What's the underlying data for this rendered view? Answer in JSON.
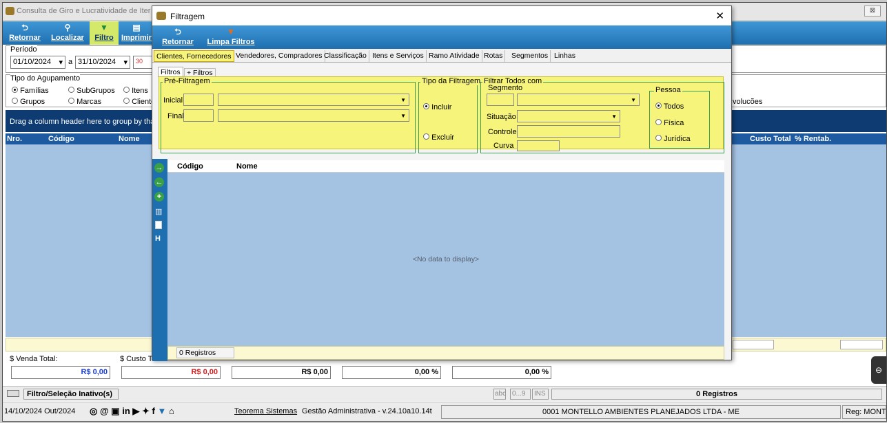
{
  "main": {
    "title": "Consulta de Giro e Lucratividade de Iter",
    "toolbar": [
      "Retornar",
      "Localizar",
      "Filtro",
      "Imprimir"
    ],
    "periodo_label": "Período",
    "date_from": "01/10/2024",
    "date_to": "31/10/2024",
    "a_label": "a",
    "cal_label": "30",
    "agrupamento_label": "Tipo do Agupamento",
    "radios": [
      "Famílias",
      "SubGrupos",
      "Itens",
      "Grupos",
      "Marcas",
      "Cliente"
    ],
    "devolucoes": "volucões",
    "drag_hint": "Drag a column header here to group by that co",
    "grid_cols": {
      "nro": "Nro.",
      "codigo": "Código",
      "nome": "Nome",
      "custo_total": "Custo Total",
      "rentab": "% Rentab."
    },
    "totals": {
      "venda_label": "$ Venda Total:",
      "venda_value": "R$ 0,00",
      "custo_label": "$ Custo Total",
      "custo_value": "R$ 0,00",
      "v3": "R$ 0,00",
      "v4": "0,00 %",
      "v5": "0,00 %"
    },
    "filter_status": "Filtro/Seleção Inativo(s)",
    "abc": "abc",
    "range": "0...9",
    "ins": "INS",
    "registros": "0 Registros",
    "date": "14/10/2024 Out/2024",
    "company_link": "Teorema Sistemas",
    "version": "Gestão Administrativa - v.24.10a10.14t",
    "company": "0001 MONTELLO AMBIENTES PLANEJADOS LTDA - ME",
    "reg": "Reg: MONTI",
    "close": "⊠"
  },
  "dialog": {
    "title": "Filtragem",
    "close": "✕",
    "toolbar": [
      "Retornar",
      "Limpa Filtros"
    ],
    "tabs": [
      "Clientes, Fornecedores",
      "Vendedores, Compradores",
      "Classificação",
      "Itens e Serviços",
      "Ramo Atividade",
      "Rotas",
      "Segmentos",
      "Linhas"
    ],
    "subtabs": [
      "Filtros",
      "+ Filtros"
    ],
    "pre_filtragem": "Pré-Filtragem",
    "inicial": "Inicial",
    "final": "Final",
    "tipo_filtragem": "Tipo da Filtragem",
    "incluir": "Incluir",
    "excluir": "Excluir",
    "filtrar_todos": "Filtrar Todos com",
    "segmento": "Segmento",
    "situacao": "Situação",
    "controle": "Controle",
    "curva": "Curva",
    "pessoa": "Pessoa",
    "todos": "Todos",
    "fisica": "Física",
    "juridica": "Jurídica",
    "grid_codigo": "Código",
    "grid_nome": "Nome",
    "no_data": "<No data to display>",
    "registros": "0 Registros"
  }
}
